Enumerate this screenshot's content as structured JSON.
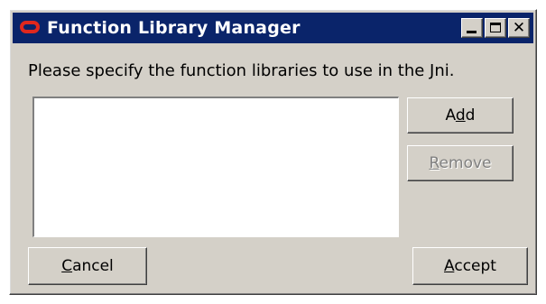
{
  "window": {
    "title": "Function Library Manager"
  },
  "prompt": "Please specify the function libraries to use in the Jni.",
  "list": {
    "items": []
  },
  "buttons": {
    "add": {
      "pre": "A",
      "mnemonic": "d",
      "post": "d"
    },
    "remove": {
      "pre": "",
      "mnemonic": "R",
      "post": "emove",
      "enabled": false
    },
    "cancel": {
      "pre": "",
      "mnemonic": "C",
      "post": "ancel"
    },
    "accept": {
      "pre": "",
      "mnemonic": "A",
      "post": "ccept"
    }
  },
  "colors": {
    "titlebar": "#0a246a",
    "face": "#d4d0c8",
    "logo": "#e0281e"
  }
}
